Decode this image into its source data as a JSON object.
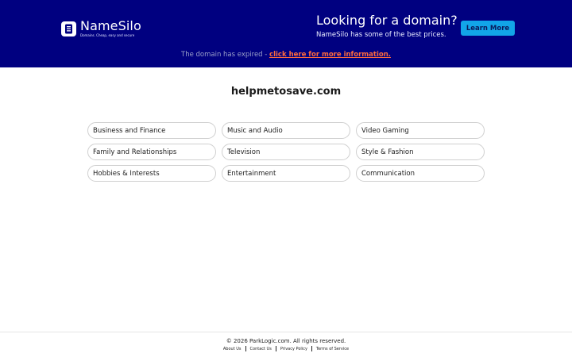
{
  "banner": {
    "logo": {
      "name": "NameSilo",
      "tagline": "Domains. Cheap, easy and secure"
    },
    "promo": {
      "title": "Looking for a domain?",
      "subtitle": "NameSilo has some of the best prices.",
      "button_label": "Learn More"
    },
    "expired": {
      "text": "The domain has expired - ",
      "link_text": "click here for more information."
    },
    "colors": {
      "background": "#000080",
      "button": "#12a5e8",
      "link": "#ff6a3d"
    }
  },
  "main": {
    "domain": "helpmetosave.com",
    "categories": [
      "Business and Finance",
      "Music and Audio",
      "Video Gaming",
      "Family and Relationships",
      "Television",
      "Style & Fashion",
      "Hobbies & Interests",
      "Entertainment",
      "Communication"
    ]
  },
  "footer": {
    "copyright": "© 2026 ParkLogic.com. All rights reserved.",
    "links": [
      "About Us",
      "Contact Us",
      "Privacy Policy",
      "Terms of Service"
    ]
  }
}
